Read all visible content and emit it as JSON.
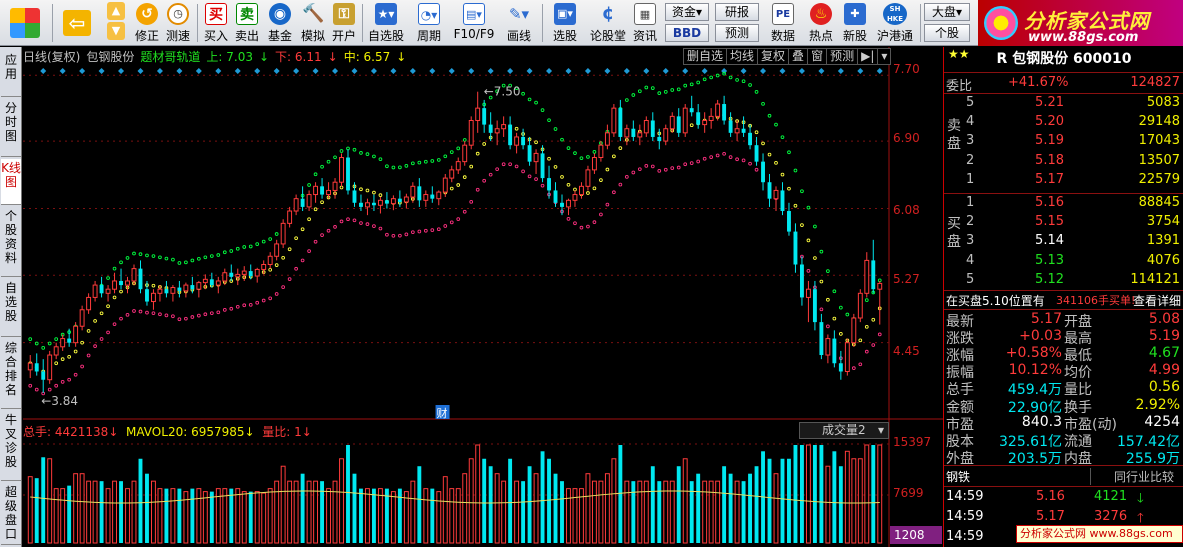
{
  "toolbar": {
    "buttons": [
      {
        "label": "修正",
        "icon": "refresh-icon"
      },
      {
        "label": "测速",
        "icon": "clock-icon"
      },
      {
        "label": "买入",
        "icon": "buy-icon",
        "glyph": "买"
      },
      {
        "label": "卖出",
        "icon": "sell-icon",
        "glyph": "卖"
      },
      {
        "label": "基金",
        "icon": "fund-icon"
      },
      {
        "label": "模拟",
        "icon": "hammer-icon"
      },
      {
        "label": "开户",
        "icon": "lock-icon"
      },
      {
        "label": "自选股",
        "icon": "star-folder-icon"
      },
      {
        "label": "周期",
        "icon": "cycle-icon"
      },
      {
        "label": "F10/F9",
        "icon": "f10-icon"
      },
      {
        "label": "画线",
        "icon": "pen-icon"
      },
      {
        "label": "选股",
        "icon": "screen-icon"
      },
      {
        "label": "论股堂",
        "icon": "forum-icon"
      },
      {
        "label": "资讯",
        "icon": "news-icon"
      },
      {
        "label": "数据",
        "icon": "pe-icon",
        "glyph": "PE"
      },
      {
        "label": "热点",
        "icon": "hot-icon"
      },
      {
        "label": "新股",
        "icon": "newstock-icon"
      },
      {
        "label": "沪港通",
        "icon": "hk-icon",
        "glyph": "SH HKE"
      }
    ],
    "small": {
      "zijin": "资金",
      "yanbao": "研报",
      "bbd": "BBD",
      "yuce": "预测",
      "dapan": "大盘",
      "gegu": "个股"
    }
  },
  "logo": {
    "title": "分析家公式网",
    "url": "www.88gs.com"
  },
  "tabs": [
    "应用",
    "分时图",
    "K线图",
    "个股资料",
    "自选股",
    "综合排名",
    "牛叉诊股",
    "超级盘口"
  ],
  "header": {
    "period": "日线(复权)",
    "stock": "包钢股份",
    "indicator": "题材哥轨道",
    "up_label": "上: 7.03",
    "down_label": "下: 6.11",
    "mid_label": "中: 6.57"
  },
  "chart_buttons": [
    "删自选",
    "均线",
    "复权",
    "叠",
    "窗",
    "预测"
  ],
  "axis": {
    "price_ticks": [
      "7.70",
      "6.90",
      "6.08",
      "5.27",
      "4.45"
    ],
    "vol_ticks": [
      "15397",
      "7699"
    ],
    "vol_current": "1208"
  },
  "annotations": {
    "high": "7.50",
    "low": "3.84",
    "cai": "财"
  },
  "vol_header": {
    "total": "总手: 4421138",
    "mavol": "MAVOL20: 6957985",
    "ratio": "量比: 1",
    "selector": "成交量2"
  },
  "colors": {
    "up": "#ff3b3b",
    "down": "#00e8f0",
    "upper_band": "#00ff40",
    "mid_band": "#ffff40",
    "lower_band": "#ff3080"
  },
  "quote": {
    "title": "R 包钢股份 600010",
    "weibi_label": "委比",
    "weibi": "+41.67%",
    "weicha": "124827",
    "sell_label": "卖盘",
    "buy_label": "买盘",
    "sell": [
      {
        "n": "5",
        "p": "5.21",
        "v": "5083"
      },
      {
        "n": "4",
        "p": "5.20",
        "v": "29148"
      },
      {
        "n": "3",
        "p": "5.19",
        "v": "17043"
      },
      {
        "n": "2",
        "p": "5.18",
        "v": "13507"
      },
      {
        "n": "1",
        "p": "5.17",
        "v": "22579"
      }
    ],
    "buy": [
      {
        "n": "1",
        "p": "5.16",
        "v": "88845"
      },
      {
        "n": "2",
        "p": "5.15",
        "v": "3754"
      },
      {
        "n": "3",
        "p": "5.14",
        "v": "1391"
      },
      {
        "n": "4",
        "p": "5.13",
        "v": "4076"
      },
      {
        "n": "5",
        "p": "5.12",
        "v": "114121"
      }
    ],
    "notice_a": "在买盘5.10位置有",
    "notice_b": "341106手买单!",
    "notice_c": "查看详细",
    "stats": [
      [
        "最新",
        "5.17",
        "开盘",
        "5.08"
      ],
      [
        "涨跌",
        "+0.03",
        "最高",
        "5.19"
      ],
      [
        "涨幅",
        "+0.58%",
        "最低",
        "4.67"
      ],
      [
        "振幅",
        "10.12%",
        "均价",
        "4.99"
      ],
      [
        "总手",
        "459.4万",
        "量比",
        "0.56"
      ],
      [
        "金额",
        "22.90亿",
        "换手",
        "2.92%"
      ],
      [
        "市盈",
        "840.3",
        "市盈(动)",
        "4254"
      ],
      [
        "股本",
        "325.61亿",
        "流通",
        "157.42亿"
      ],
      [
        "外盘",
        "203.5万",
        "内盘",
        "255.9万"
      ]
    ],
    "tab_left": "钢铁",
    "tab_right": "同行业比较",
    "ticks": [
      {
        "t": "14:59",
        "p": "5.16",
        "v": "4121",
        "dir": "down"
      },
      {
        "t": "14:59",
        "p": "5.17",
        "v": "3276",
        "dir": "up"
      },
      {
        "t": "14:59",
        "p": "",
        "v": "",
        "dir": ""
      }
    ]
  },
  "watermark": "分析家公式网 www.88gs.com",
  "chart_data": {
    "type": "candlestick",
    "price_range": [
      3.84,
      7.7
    ],
    "candles": [
      [
        4.12,
        4.3,
        4.02,
        4.2
      ],
      [
        4.2,
        4.32,
        4.05,
        4.1
      ],
      [
        4.1,
        4.25,
        3.84,
        4.0
      ],
      [
        4.0,
        4.35,
        3.95,
        4.3
      ],
      [
        4.3,
        4.45,
        4.25,
        4.4
      ],
      [
        4.4,
        4.55,
        4.35,
        4.5
      ],
      [
        4.5,
        4.62,
        4.4,
        4.45
      ],
      [
        4.45,
        4.7,
        4.4,
        4.65
      ],
      [
        4.65,
        4.9,
        4.6,
        4.85
      ],
      [
        4.85,
        5.05,
        4.8,
        5.0
      ],
      [
        5.0,
        5.2,
        4.95,
        5.15
      ],
      [
        5.15,
        5.25,
        5.0,
        5.05
      ],
      [
        5.05,
        5.15,
        4.95,
        5.1
      ],
      [
        5.1,
        5.3,
        5.05,
        5.2
      ],
      [
        5.2,
        5.35,
        5.1,
        5.15
      ],
      [
        5.15,
        5.25,
        5.05,
        5.2
      ],
      [
        5.2,
        5.4,
        5.15,
        5.35
      ],
      [
        5.35,
        5.45,
        5.05,
        5.1
      ],
      [
        5.1,
        5.2,
        4.9,
        4.95
      ],
      [
        4.95,
        5.1,
        4.85,
        5.05
      ],
      [
        5.05,
        5.15,
        4.95,
        5.1
      ],
      [
        5.1,
        5.2,
        5.0,
        5.05
      ],
      [
        5.05,
        5.15,
        4.95,
        5.12
      ],
      [
        5.12,
        5.2,
        5.0,
        5.08
      ],
      [
        5.08,
        5.18,
        5.0,
        5.15
      ],
      [
        5.15,
        5.25,
        5.05,
        5.1
      ],
      [
        5.1,
        5.2,
        5.0,
        5.18
      ],
      [
        5.18,
        5.28,
        5.1,
        5.22
      ],
      [
        5.22,
        5.3,
        5.12,
        5.15
      ],
      [
        5.15,
        5.25,
        5.05,
        5.2
      ],
      [
        5.2,
        5.35,
        5.15,
        5.3
      ],
      [
        5.3,
        5.4,
        5.2,
        5.25
      ],
      [
        5.25,
        5.35,
        5.15,
        5.28
      ],
      [
        5.28,
        5.38,
        5.2,
        5.32
      ],
      [
        5.32,
        5.4,
        5.22,
        5.26
      ],
      [
        5.26,
        5.36,
        5.18,
        5.34
      ],
      [
        5.34,
        5.45,
        5.28,
        5.4
      ],
      [
        5.4,
        5.55,
        5.35,
        5.5
      ],
      [
        5.5,
        5.7,
        5.45,
        5.65
      ],
      [
        5.65,
        5.95,
        5.6,
        5.9
      ],
      [
        5.9,
        6.1,
        5.85,
        6.05
      ],
      [
        6.05,
        6.25,
        6.0,
        6.2
      ],
      [
        6.2,
        6.35,
        6.05,
        6.1
      ],
      [
        6.1,
        6.3,
        6.05,
        6.25
      ],
      [
        6.25,
        6.4,
        6.15,
        6.35
      ],
      [
        6.35,
        6.45,
        6.2,
        6.25
      ],
      [
        6.25,
        6.4,
        6.2,
        6.3
      ],
      [
        6.3,
        6.45,
        6.2,
        6.4
      ],
      [
        6.4,
        6.75,
        6.35,
        6.7
      ],
      [
        6.7,
        6.8,
        6.25,
        6.3
      ],
      [
        6.3,
        6.4,
        6.1,
        6.15
      ],
      [
        6.15,
        6.25,
        6.05,
        6.1
      ],
      [
        6.1,
        6.2,
        6.0,
        6.15
      ],
      [
        6.15,
        6.25,
        6.05,
        6.12
      ],
      [
        6.12,
        6.22,
        6.02,
        6.18
      ],
      [
        6.18,
        6.28,
        6.08,
        6.14
      ],
      [
        6.14,
        6.24,
        6.06,
        6.2
      ],
      [
        6.2,
        6.3,
        6.1,
        6.16
      ],
      [
        6.16,
        6.26,
        6.08,
        6.22
      ],
      [
        6.22,
        6.4,
        6.15,
        6.35
      ],
      [
        6.35,
        6.45,
        6.1,
        6.18
      ],
      [
        6.18,
        6.3,
        6.1,
        6.25
      ],
      [
        6.25,
        6.35,
        6.15,
        6.2
      ],
      [
        6.2,
        6.3,
        6.12,
        6.28
      ],
      [
        6.28,
        6.5,
        6.22,
        6.45
      ],
      [
        6.45,
        6.6,
        6.4,
        6.55
      ],
      [
        6.55,
        6.7,
        6.5,
        6.65
      ],
      [
        6.65,
        6.9,
        6.6,
        6.85
      ],
      [
        6.85,
        7.2,
        6.8,
        7.15
      ],
      [
        7.15,
        7.5,
        7.0,
        7.3
      ],
      [
        7.3,
        7.4,
        7.0,
        7.1
      ],
      [
        7.1,
        7.25,
        6.9,
        7.0
      ],
      [
        7.0,
        7.15,
        6.85,
        7.05
      ],
      [
        7.05,
        7.2,
        6.95,
        7.1
      ],
      [
        7.1,
        7.2,
        6.8,
        6.85
      ],
      [
        6.85,
        7.0,
        6.75,
        6.95
      ],
      [
        6.95,
        7.05,
        6.8,
        6.85
      ],
      [
        6.85,
        6.95,
        6.6,
        6.65
      ],
      [
        6.65,
        6.8,
        6.5,
        6.75
      ],
      [
        6.75,
        6.85,
        6.4,
        6.45
      ],
      [
        6.45,
        6.6,
        6.2,
        6.3
      ],
      [
        6.3,
        6.4,
        6.1,
        6.15
      ],
      [
        6.15,
        6.25,
        6.0,
        6.1
      ],
      [
        6.1,
        6.2,
        6.0,
        6.18
      ],
      [
        6.18,
        6.3,
        6.1,
        6.25
      ],
      [
        6.25,
        6.4,
        6.2,
        6.35
      ],
      [
        6.35,
        6.6,
        6.3,
        6.55
      ],
      [
        6.55,
        6.75,
        6.5,
        6.7
      ],
      [
        6.7,
        6.9,
        6.65,
        6.85
      ],
      [
        6.85,
        7.1,
        6.8,
        7.0
      ],
      [
        7.0,
        7.35,
        6.95,
        7.3
      ],
      [
        7.3,
        7.4,
        6.9,
        6.95
      ],
      [
        6.95,
        7.1,
        6.85,
        7.05
      ],
      [
        7.05,
        7.15,
        6.9,
        6.95
      ],
      [
        6.95,
        7.1,
        6.85,
        7.0
      ],
      [
        7.0,
        7.2,
        6.95,
        7.15
      ],
      [
        7.15,
        7.25,
        6.9,
        6.95
      ],
      [
        6.95,
        7.05,
        6.8,
        6.9
      ],
      [
        6.9,
        7.1,
        6.85,
        7.05
      ],
      [
        7.05,
        7.25,
        7.0,
        7.2
      ],
      [
        7.2,
        7.3,
        6.95,
        7.0
      ],
      [
        7.0,
        7.35,
        6.95,
        7.3
      ],
      [
        7.3,
        7.45,
        7.2,
        7.25
      ],
      [
        7.25,
        7.35,
        7.05,
        7.1
      ],
      [
        7.1,
        7.25,
        7.0,
        7.15
      ],
      [
        7.15,
        7.3,
        7.05,
        7.2
      ],
      [
        7.2,
        7.4,
        7.15,
        7.35
      ],
      [
        7.35,
        7.45,
        7.1,
        7.15
      ],
      [
        7.15,
        7.25,
        6.95,
        7.0
      ],
      [
        7.0,
        7.15,
        6.9,
        7.05
      ],
      [
        7.05,
        7.2,
        6.95,
        7.0
      ],
      [
        7.0,
        7.1,
        6.8,
        6.85
      ],
      [
        6.85,
        6.95,
        6.6,
        6.65
      ],
      [
        6.65,
        6.75,
        6.3,
        6.4
      ],
      [
        6.4,
        6.5,
        6.1,
        6.2
      ],
      [
        6.2,
        6.35,
        6.05,
        6.3
      ],
      [
        6.3,
        6.4,
        6.0,
        6.05
      ],
      [
        6.05,
        6.15,
        5.75,
        5.8
      ],
      [
        5.8,
        5.9,
        5.3,
        5.4
      ],
      [
        5.4,
        5.5,
        4.9,
        5.0
      ],
      [
        5.0,
        5.2,
        4.7,
        5.1
      ],
      [
        5.1,
        5.2,
        4.6,
        4.7
      ],
      [
        4.7,
        4.8,
        4.25,
        4.3
      ],
      [
        4.3,
        4.55,
        4.2,
        4.5
      ],
      [
        4.5,
        4.6,
        4.15,
        4.2
      ],
      [
        4.2,
        4.35,
        4.0,
        4.1
      ],
      [
        4.1,
        4.5,
        4.05,
        4.45
      ],
      [
        4.45,
        4.8,
        4.4,
        4.75
      ],
      [
        4.75,
        5.1,
        4.7,
        5.05
      ],
      [
        5.05,
        5.55,
        5.0,
        5.45
      ],
      [
        5.45,
        5.7,
        5.05,
        5.1
      ],
      [
        5.1,
        5.2,
        4.67,
        5.17
      ]
    ],
    "bands": {
      "upper": 7.03,
      "middle": 6.57,
      "lower": 6.11
    },
    "volume_range": [
      0,
      15397
    ]
  }
}
